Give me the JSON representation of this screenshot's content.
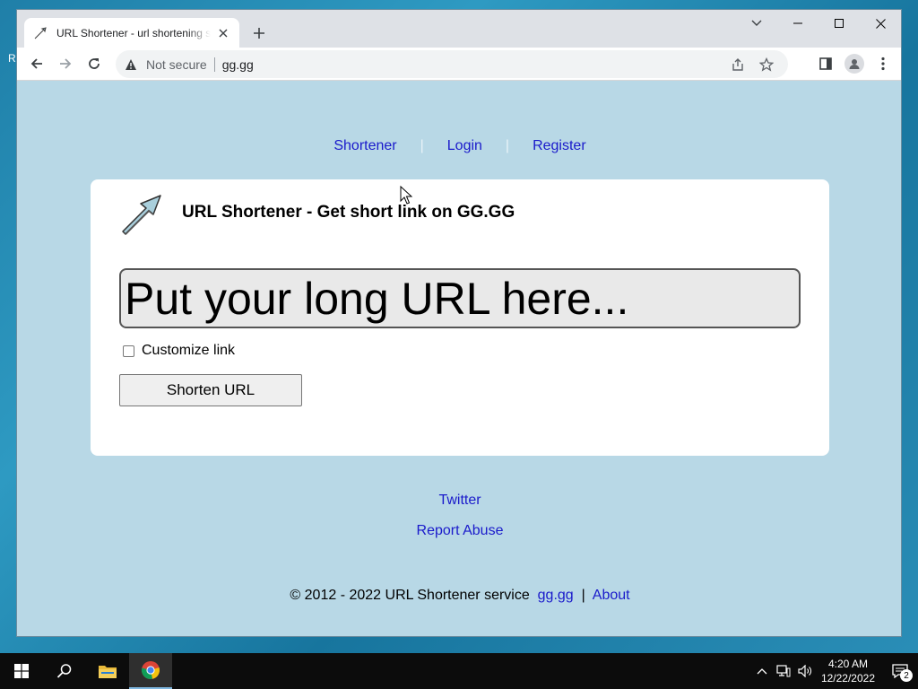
{
  "desktop": {
    "label": "R"
  },
  "browser": {
    "tab": {
      "title": "URL Shortener - url shortening service"
    },
    "omnibox": {
      "security": "Not secure",
      "url": "gg.gg"
    }
  },
  "page": {
    "nav": {
      "items": [
        "Shortener",
        "Login",
        "Register"
      ]
    },
    "card": {
      "title": "URL Shortener - Get short link on GG.GG",
      "input_placeholder": "Put your long URL here...",
      "customize_label": "Customize link",
      "button_label": "Shorten URL"
    },
    "links": {
      "twitter": "Twitter",
      "report": "Report Abuse"
    },
    "footer": {
      "copyright": "© 2012 - 2022 URL Shortener service",
      "site_link": "gg.gg",
      "divider": "|",
      "about": "About"
    }
  },
  "taskbar": {
    "time": "4:20 AM",
    "date": "12/22/2022",
    "notification_count": "2"
  },
  "colors": {
    "page_bg": "#b8d8e6",
    "link": "#1a1acb",
    "card_bg": "#ffffff"
  }
}
